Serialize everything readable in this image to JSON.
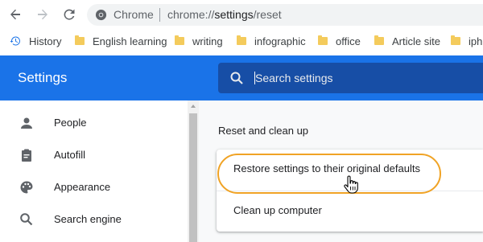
{
  "browser": {
    "site_name": "Chrome",
    "url_scheme": "chrome://",
    "url_host": "settings",
    "url_path": "/reset",
    "icons": {
      "back": "arrow-left-icon",
      "forward": "arrow-right-icon",
      "reload": "reload-icon",
      "site": "chrome-info-icon"
    }
  },
  "bookmarks": [
    {
      "label": "History",
      "icon": "history-icon"
    },
    {
      "label": "English learning",
      "icon": "folder-icon"
    },
    {
      "label": "writing",
      "icon": "folder-icon"
    },
    {
      "label": "infographic",
      "icon": "folder-icon"
    },
    {
      "label": "office",
      "icon": "folder-icon"
    },
    {
      "label": "Article site",
      "icon": "folder-icon"
    },
    {
      "label": "iph",
      "icon": "folder-icon"
    }
  ],
  "header": {
    "title": "Settings",
    "search_placeholder": "Search settings"
  },
  "sidebar": {
    "items": [
      {
        "label": "People",
        "icon": "person-icon"
      },
      {
        "label": "Autofill",
        "icon": "clipboard-icon"
      },
      {
        "label": "Appearance",
        "icon": "palette-icon"
      },
      {
        "label": "Search engine",
        "icon": "search-icon"
      }
    ]
  },
  "main": {
    "section_title": "Reset and clean up",
    "rows": [
      {
        "label": "Restore settings to their original defaults"
      },
      {
        "label": "Clean up computer"
      }
    ]
  },
  "colors": {
    "header_blue": "#1a73e8",
    "search_blue": "#174ea6",
    "highlight_orange": "#f0a325",
    "folder_yellow": "#f4cb5c"
  }
}
